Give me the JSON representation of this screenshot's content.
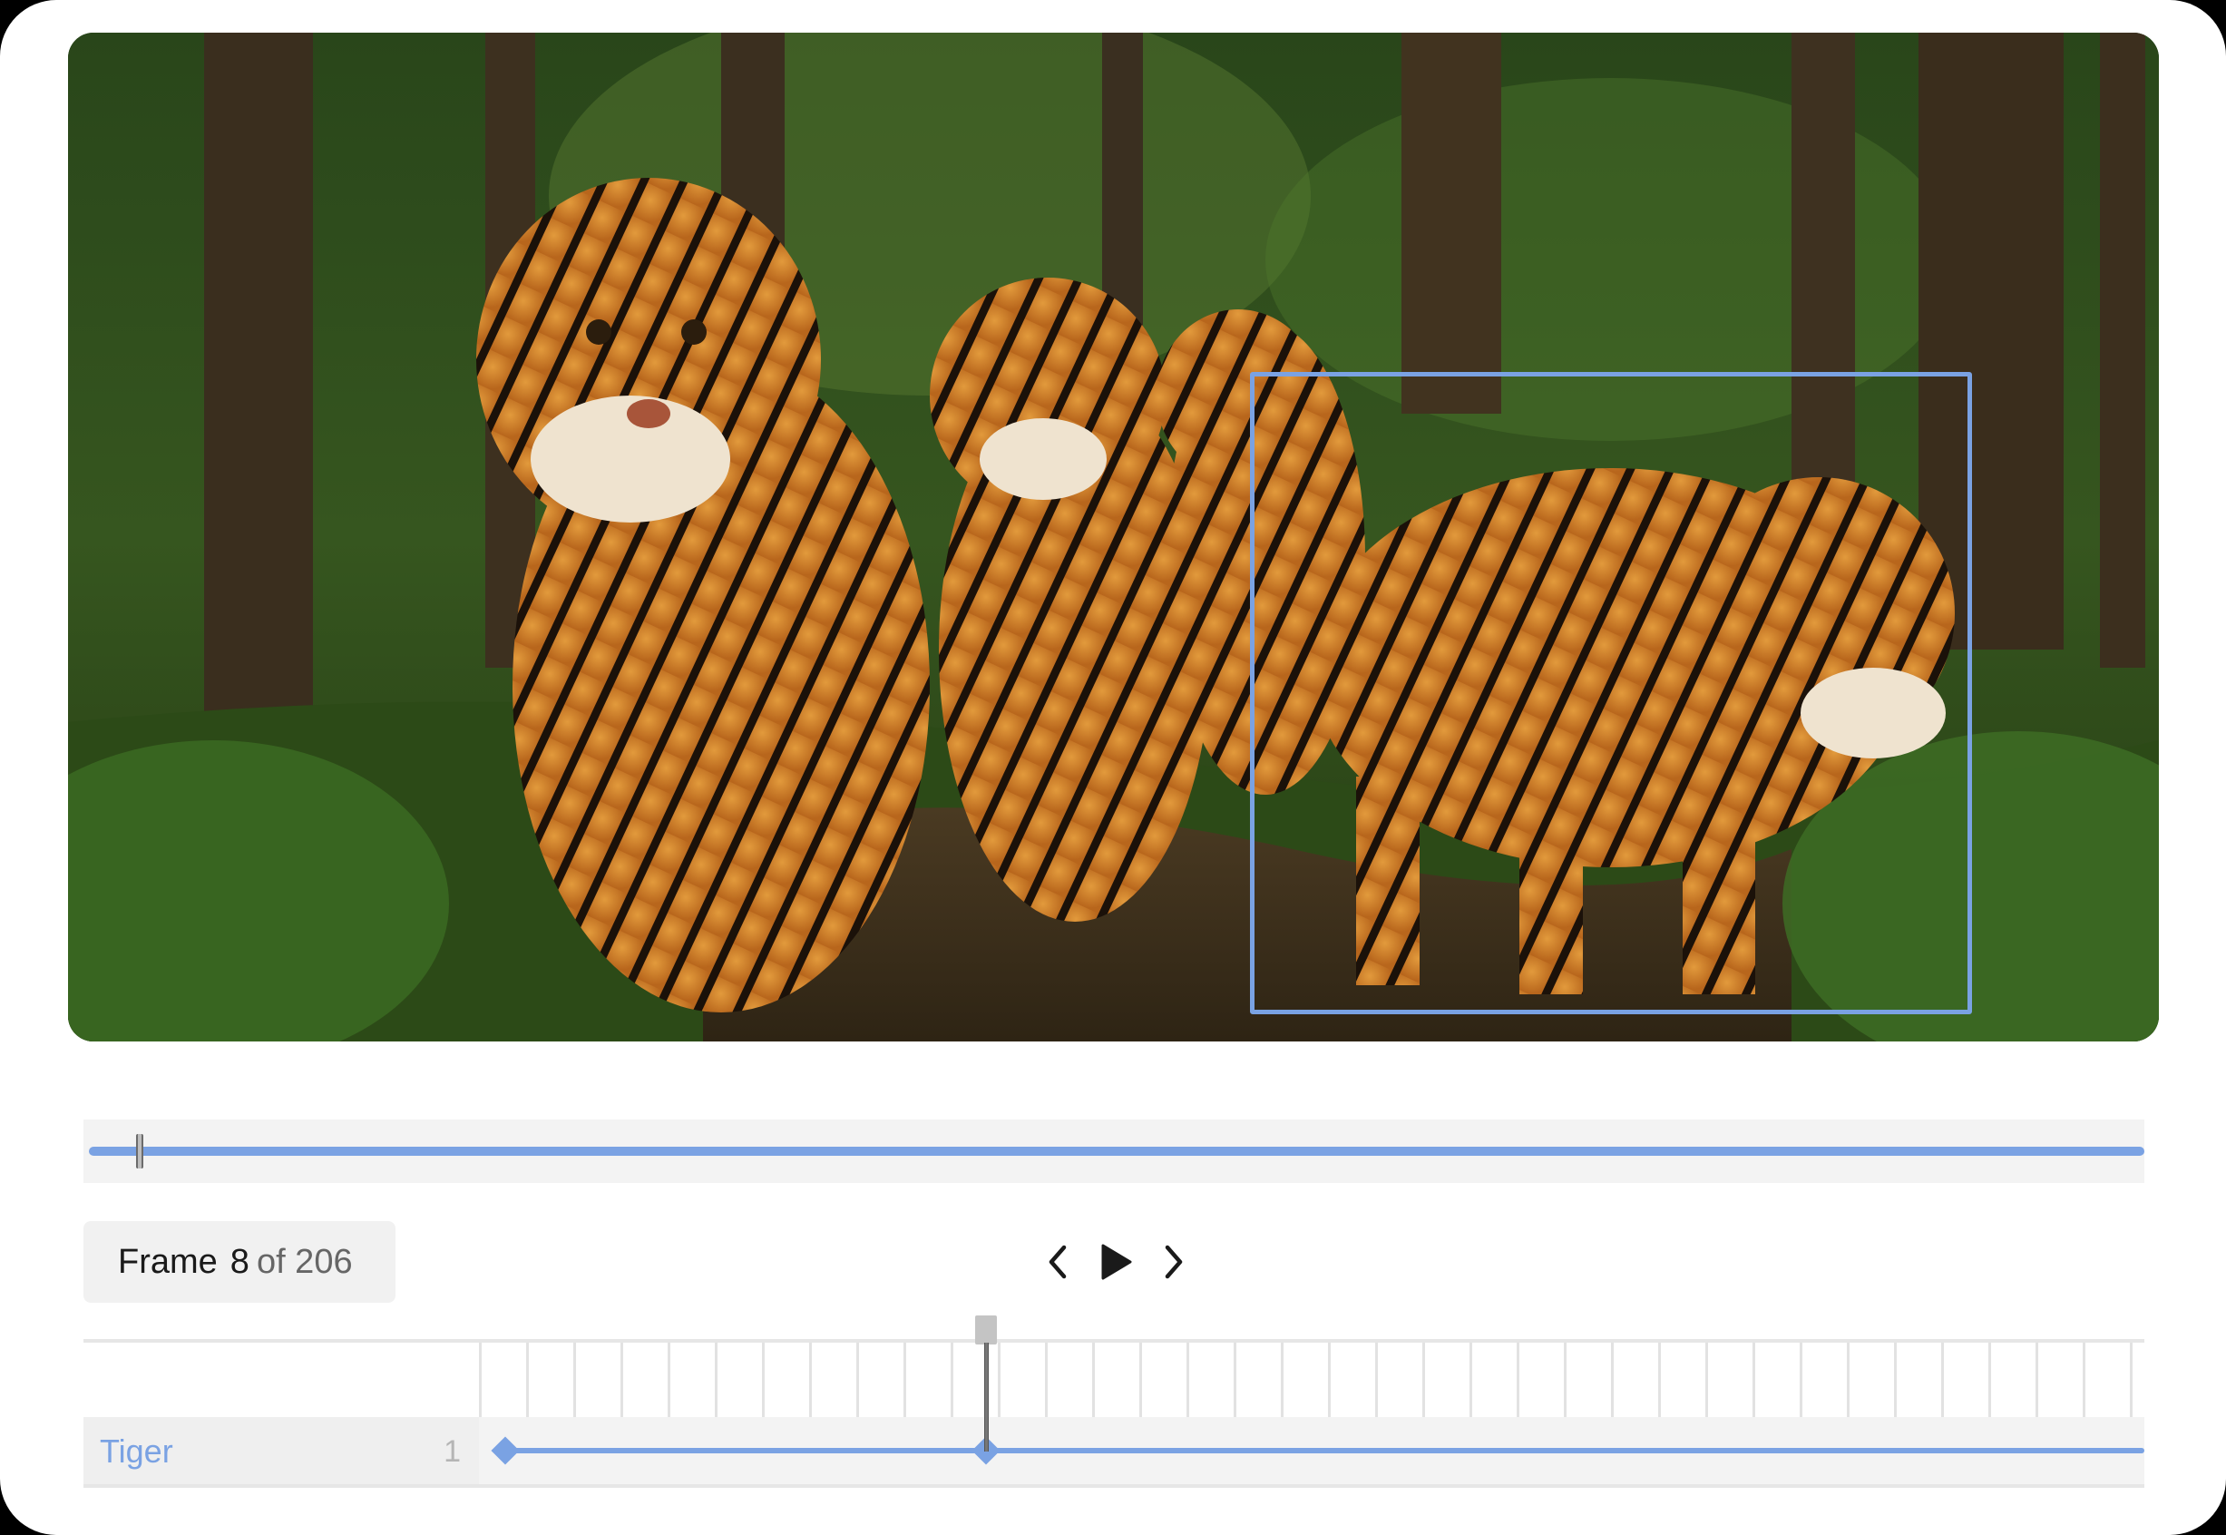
{
  "viewer": {
    "image_subject": "tigers-in-forest",
    "selection": {
      "label": "Tiger",
      "color": "#7aa2e3"
    }
  },
  "frame": {
    "label": "Frame",
    "current": "8",
    "of_text": "of 206"
  },
  "controls": {
    "prev_icon": "chevron-left-icon",
    "play_icon": "play-icon",
    "next_icon": "chevron-right-icon"
  },
  "timeline": {
    "tracks": [
      {
        "name": "Tiger",
        "count": "1"
      }
    ]
  },
  "colors": {
    "accent": "#7aa2e3",
    "panel": "#f1f1f1",
    "text": "#1a1a1a",
    "muted": "#666666"
  }
}
